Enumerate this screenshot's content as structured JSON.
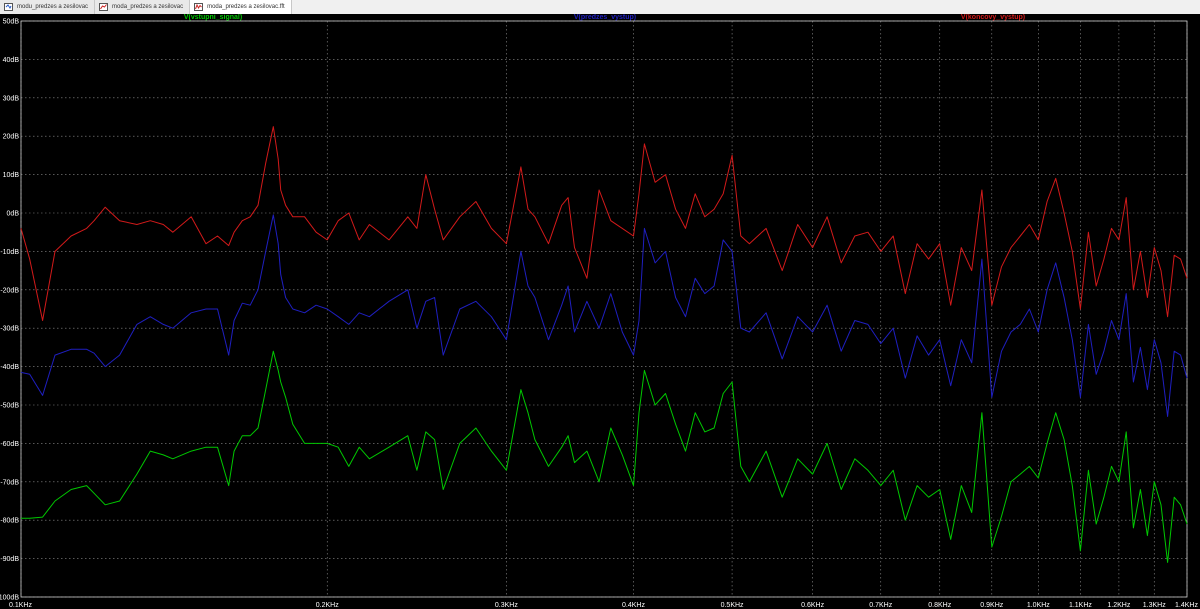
{
  "tabs": [
    {
      "label": "modu_predzes a zesilovac"
    },
    {
      "label": "moda_predzes a zesilovac"
    },
    {
      "label": "moda_predzes a zesilovac.fft"
    }
  ],
  "colors": {
    "background": "#000000",
    "grid": "#8c8c8c",
    "input": "#00c800",
    "pre": "#1f1fc0",
    "out": "#d21a1a"
  },
  "chart_data": {
    "type": "line",
    "xscale": "log",
    "xlim": [
      0.1,
      1.4
    ],
    "ylim": [
      -100,
      50
    ],
    "yticks": [
      50,
      40,
      30,
      20,
      10,
      0,
      -10,
      -20,
      -30,
      -40,
      -50,
      -60,
      -70,
      -80,
      -90,
      -100
    ],
    "yticklabels": [
      "50dB",
      "40dB",
      "30dB",
      "20dB",
      "10dB",
      "0dB",
      "-10dB",
      "-20dB",
      "-30dB",
      "-40dB",
      "-50dB",
      "-60dB",
      "-70dB",
      "-80dB",
      "-90dB",
      "-100dB"
    ],
    "xticks": [
      0.1,
      0.2,
      0.3,
      0.4,
      0.5,
      0.6,
      0.7,
      0.8,
      0.9,
      1.0,
      1.1,
      1.2,
      1.3,
      1.4
    ],
    "xticklabels": [
      "0.1KHz",
      "0.2KHz",
      "0.3KHz",
      "0.4KHz",
      "0.5KHz",
      "0.6KHz",
      "0.7KHz",
      "0.8KHz",
      "0.9KHz",
      "1.0KHz",
      "1.1KHz",
      "1.2KHz",
      "1.3KHz",
      "1.4KHz"
    ],
    "grid": true,
    "series": [
      {
        "name": "V(vstupni_signal)",
        "color": "#00c800",
        "x": [
          0.1,
          0.102,
          0.105,
          0.108,
          0.112,
          0.116,
          0.118,
          0.121,
          0.125,
          0.13,
          0.134,
          0.138,
          0.141,
          0.147,
          0.152,
          0.156,
          0.16,
          0.162,
          0.165,
          0.168,
          0.171,
          0.174,
          0.177,
          0.179,
          0.18,
          0.182,
          0.185,
          0.19,
          0.195,
          0.2,
          0.205,
          0.21,
          0.215,
          0.22,
          0.23,
          0.24,
          0.245,
          0.25,
          0.255,
          0.26,
          0.27,
          0.28,
          0.29,
          0.3,
          0.31,
          0.315,
          0.32,
          0.33,
          0.34,
          0.345,
          0.35,
          0.36,
          0.37,
          0.38,
          0.39,
          0.4,
          0.405,
          0.41,
          0.42,
          0.43,
          0.44,
          0.45,
          0.46,
          0.47,
          0.48,
          0.49,
          0.5,
          0.51,
          0.52,
          0.54,
          0.56,
          0.58,
          0.6,
          0.62,
          0.64,
          0.66,
          0.68,
          0.7,
          0.72,
          0.74,
          0.76,
          0.78,
          0.8,
          0.82,
          0.84,
          0.86,
          0.88,
          0.9,
          0.92,
          0.94,
          0.96,
          0.98,
          1.0,
          1.02,
          1.04,
          1.06,
          1.08,
          1.1,
          1.12,
          1.14,
          1.16,
          1.18,
          1.2,
          1.22,
          1.24,
          1.26,
          1.28,
          1.3,
          1.32,
          1.34,
          1.36,
          1.38,
          1.4
        ],
        "y": [
          -79.5,
          -79.5,
          -79.2,
          -75,
          -72,
          -71,
          -73,
          -76,
          -75,
          -68,
          -62,
          -63,
          -64,
          -62,
          -61,
          -61,
          -71,
          -62,
          -58,
          -58,
          -56,
          -46,
          -36,
          -41,
          -44,
          -48,
          -55,
          -60,
          -60,
          -60,
          -61,
          -66,
          -61,
          -64,
          -61,
          -58,
          -67,
          -57,
          -59,
          -72,
          -60,
          -56,
          -62,
          -67,
          -46,
          -52,
          -59,
          -66,
          -61,
          -58,
          -65,
          -62,
          -70,
          -56,
          -63,
          -71,
          -52,
          -41,
          -50,
          -47,
          -55,
          -62,
          -52,
          -57,
          -56,
          -47,
          -44,
          -66,
          -70,
          -62,
          -74,
          -64,
          -68,
          -60,
          -72,
          -64,
          -67,
          -71,
          -67,
          -80,
          -71,
          -74,
          -72,
          -85,
          -71,
          -78,
          -52,
          -87,
          -79,
          -70,
          -68,
          -66,
          -69,
          -60,
          -52,
          -59,
          -71,
          -88,
          -67,
          -81,
          -74,
          -66,
          -70,
          -57,
          -82,
          -72,
          -84,
          -70,
          -76,
          -91,
          -74,
          -76,
          -81
        ]
      },
      {
        "name": "V(predzes_vystup)",
        "color": "#1f1fc0",
        "x": [
          0.1,
          0.102,
          0.105,
          0.108,
          0.112,
          0.116,
          0.118,
          0.121,
          0.125,
          0.13,
          0.134,
          0.138,
          0.141,
          0.147,
          0.152,
          0.156,
          0.16,
          0.162,
          0.165,
          0.168,
          0.171,
          0.174,
          0.177,
          0.179,
          0.18,
          0.182,
          0.185,
          0.19,
          0.195,
          0.2,
          0.205,
          0.21,
          0.215,
          0.22,
          0.23,
          0.24,
          0.245,
          0.25,
          0.255,
          0.26,
          0.27,
          0.28,
          0.29,
          0.3,
          0.31,
          0.315,
          0.32,
          0.33,
          0.34,
          0.345,
          0.35,
          0.36,
          0.37,
          0.38,
          0.39,
          0.4,
          0.405,
          0.41,
          0.42,
          0.43,
          0.44,
          0.45,
          0.46,
          0.47,
          0.48,
          0.49,
          0.5,
          0.51,
          0.52,
          0.54,
          0.56,
          0.58,
          0.6,
          0.62,
          0.64,
          0.66,
          0.68,
          0.7,
          0.72,
          0.74,
          0.76,
          0.78,
          0.8,
          0.82,
          0.84,
          0.86,
          0.88,
          0.9,
          0.92,
          0.94,
          0.96,
          0.98,
          1.0,
          1.02,
          1.04,
          1.06,
          1.08,
          1.1,
          1.12,
          1.14,
          1.16,
          1.18,
          1.2,
          1.22,
          1.24,
          1.26,
          1.28,
          1.3,
          1.32,
          1.34,
          1.36,
          1.38,
          1.4
        ],
        "y": [
          -41.5,
          -42,
          -47.5,
          -37,
          -35.5,
          -35.5,
          -36.5,
          -40,
          -37,
          -29,
          -27,
          -29,
          -30,
          -26,
          -25,
          -25,
          -37,
          -28,
          -23.5,
          -24,
          -20,
          -10,
          -0.5,
          -8,
          -16,
          -22,
          -25,
          -26,
          -24,
          -25,
          -27,
          -29,
          -26,
          -27,
          -23,
          -20,
          -30,
          -23,
          -22,
          -37,
          -25,
          -23,
          -27,
          -33,
          -10,
          -19,
          -22,
          -33,
          -24,
          -19,
          -31,
          -23,
          -30,
          -21,
          -31,
          -37,
          -28,
          -4,
          -13,
          -10,
          -22,
          -27,
          -17,
          -21,
          -19,
          -7,
          -10,
          -30,
          -31,
          -26,
          -38,
          -27,
          -31,
          -24,
          -36,
          -28,
          -29,
          -34,
          -30,
          -43,
          -32,
          -37,
          -33,
          -45,
          -33,
          -39,
          -12,
          -48,
          -36,
          -31,
          -29,
          -25,
          -31,
          -20,
          -13,
          -22,
          -33,
          -48,
          -29,
          -42,
          -36,
          -28,
          -33,
          -21,
          -44,
          -35,
          -46,
          -33,
          -39,
          -53,
          -36,
          -37,
          -43
        ]
      },
      {
        "name": "V(koncovy_vystup)",
        "color": "#d21a1a",
        "x": [
          0.1,
          0.102,
          0.105,
          0.108,
          0.112,
          0.116,
          0.118,
          0.121,
          0.125,
          0.13,
          0.134,
          0.138,
          0.141,
          0.147,
          0.152,
          0.156,
          0.16,
          0.162,
          0.165,
          0.168,
          0.171,
          0.174,
          0.177,
          0.179,
          0.18,
          0.182,
          0.185,
          0.19,
          0.195,
          0.2,
          0.205,
          0.21,
          0.215,
          0.22,
          0.23,
          0.24,
          0.245,
          0.25,
          0.255,
          0.26,
          0.27,
          0.28,
          0.29,
          0.3,
          0.31,
          0.315,
          0.32,
          0.33,
          0.34,
          0.345,
          0.35,
          0.36,
          0.37,
          0.38,
          0.39,
          0.4,
          0.405,
          0.41,
          0.42,
          0.43,
          0.44,
          0.45,
          0.46,
          0.47,
          0.48,
          0.49,
          0.5,
          0.51,
          0.52,
          0.54,
          0.56,
          0.58,
          0.6,
          0.62,
          0.64,
          0.66,
          0.68,
          0.7,
          0.72,
          0.74,
          0.76,
          0.78,
          0.8,
          0.82,
          0.84,
          0.86,
          0.88,
          0.9,
          0.92,
          0.94,
          0.96,
          0.98,
          1.0,
          1.02,
          1.04,
          1.06,
          1.08,
          1.1,
          1.12,
          1.14,
          1.16,
          1.18,
          1.2,
          1.22,
          1.24,
          1.26,
          1.28,
          1.3,
          1.32,
          1.34,
          1.36,
          1.38,
          1.4
        ],
        "y": [
          -4,
          -12,
          -28,
          -10,
          -6,
          -4,
          -2,
          1.5,
          -2,
          -3,
          -2,
          -3,
          -5,
          -1,
          -8,
          -6,
          -8.5,
          -5,
          -2,
          -1,
          2,
          13,
          22.5,
          14,
          6,
          2,
          -1,
          -1,
          -5,
          -7,
          -2,
          0,
          -7,
          -3,
          -7,
          -1,
          -4,
          10,
          1,
          -7,
          -1,
          3,
          -4,
          -8,
          12,
          1,
          -1,
          -8,
          2,
          4,
          -9,
          -17,
          6,
          -2,
          -4,
          -6,
          5,
          18,
          8,
          10,
          1,
          -4,
          5,
          -1,
          1,
          5,
          15,
          -6,
          -8,
          -4,
          -15,
          -3,
          -9,
          -1,
          -13,
          -6,
          -5,
          -10,
          -6,
          -21,
          -8,
          -12,
          -8,
          -24,
          -9,
          -15,
          6,
          -24,
          -14,
          -9,
          -6,
          -3,
          -7,
          3,
          9,
          0,
          -10,
          -25,
          -5,
          -19,
          -12,
          -4,
          -7,
          4,
          -20,
          -10,
          -22,
          -9,
          -15,
          -27,
          -11,
          -12,
          -17
        ]
      }
    ]
  }
}
